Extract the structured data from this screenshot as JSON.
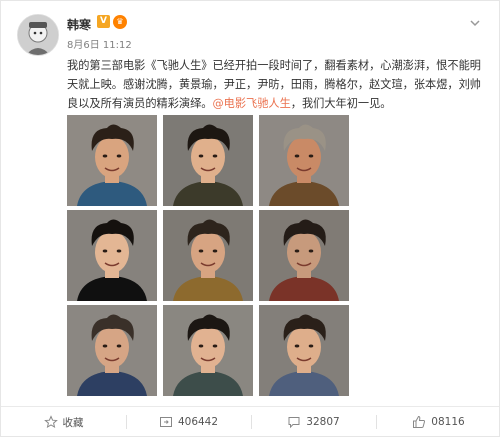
{
  "post": {
    "username": "韩寒",
    "verified_badge": "V",
    "time": "8月6日 11:12",
    "text_before": "我的第三部电影《飞驰人生》已经开拍一段时间了，翻看素材，心潮澎湃，恨不能明天就上映。感谢沈腾，黄景瑜，尹正，尹昉，田雨，腾格尔，赵文瑄，张本煜，刘帅良以及所有演员的精彩演绎。",
    "mention": "@电影飞驰人生",
    "text_after": "，我们大年初一见。",
    "photos": [
      {
        "skin": "#d9a47f",
        "hair": "#2b2018",
        "bg": "#8f8a84",
        "shirt": "#2e5a7e"
      },
      {
        "skin": "#e0b08c",
        "hair": "#1d1712",
        "bg": "#7d7a75",
        "shirt": "#3c3a2a"
      },
      {
        "skin": "#c98a66",
        "hair": "#9a9286",
        "bg": "#8e8984",
        "shirt": "#6b4b2a"
      },
      {
        "skin": "#e3b694",
        "hair": "#15110e",
        "bg": "#86827d",
        "shirt": "#101010"
      },
      {
        "skin": "#d7a482",
        "hair": "#2d241c",
        "bg": "#7e7a74",
        "shirt": "#8d6a2e"
      },
      {
        "skin": "#c79a7c",
        "hair": "#241c17",
        "bg": "#807b75",
        "shirt": "#7a3328"
      },
      {
        "skin": "#d6a585",
        "hair": "#3a3029",
        "bg": "#8b8782",
        "shirt": "#2d3f62"
      },
      {
        "skin": "#e1b291",
        "hair": "#1c1713",
        "bg": "#8a8781",
        "shirt": "#3d4d4a"
      },
      {
        "skin": "#deae8b",
        "hair": "#2a2019",
        "bg": "#837f7a",
        "shirt": "#4f5f7d"
      }
    ]
  },
  "actions": {
    "favorite": "收藏",
    "repost": "406442",
    "comment": "32807",
    "like": "08116"
  },
  "colors": {
    "mention": "#eb7350",
    "verified": "#f5a623",
    "vip": "#ff8200"
  },
  "icons": [
    "user-avatar",
    "verified-badge",
    "vip-icon",
    "chevron-down-icon",
    "star-icon",
    "repost-icon",
    "comment-icon",
    "like-icon"
  ]
}
